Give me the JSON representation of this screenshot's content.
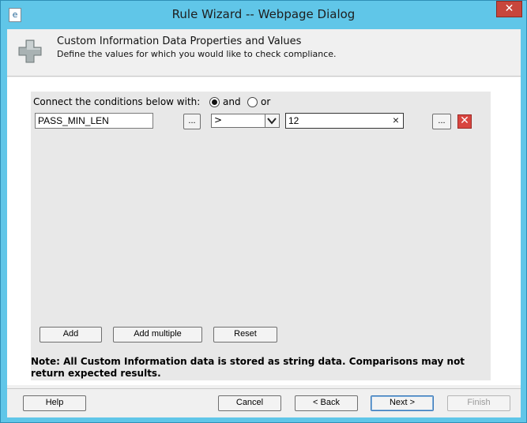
{
  "window": {
    "title": "Rule Wizard -- Webpage Dialog",
    "close_label": "✕"
  },
  "header": {
    "title": "Custom Information Data Properties and Values",
    "subtitle": "Define the values for which you would like to check compliance."
  },
  "conditions": {
    "connect_label": "Connect the conditions below with:",
    "and_label": "and",
    "or_label": "or",
    "selected_connector": "and",
    "row": {
      "name_value": "PASS_MIN_LEN",
      "browse_label": "...",
      "operator_value": ">",
      "value_value": "12",
      "value_browse_label": "...",
      "delete_label": "✕"
    }
  },
  "actions": {
    "add_label": "Add",
    "add_multiple_label": "Add multiple",
    "reset_label": "Reset"
  },
  "note": "Note: All Custom Information data is stored as string data. Comparisons may not return expected results.",
  "footer": {
    "help_label": "Help",
    "cancel_label": "Cancel",
    "back_label": "< Back",
    "next_label": "Next >",
    "finish_label": "Finish"
  },
  "colors": {
    "title_bar": "#60c6e8",
    "close_button": "#c7463c",
    "delete_button": "#d8453f",
    "panel": "#e8e8e8"
  }
}
